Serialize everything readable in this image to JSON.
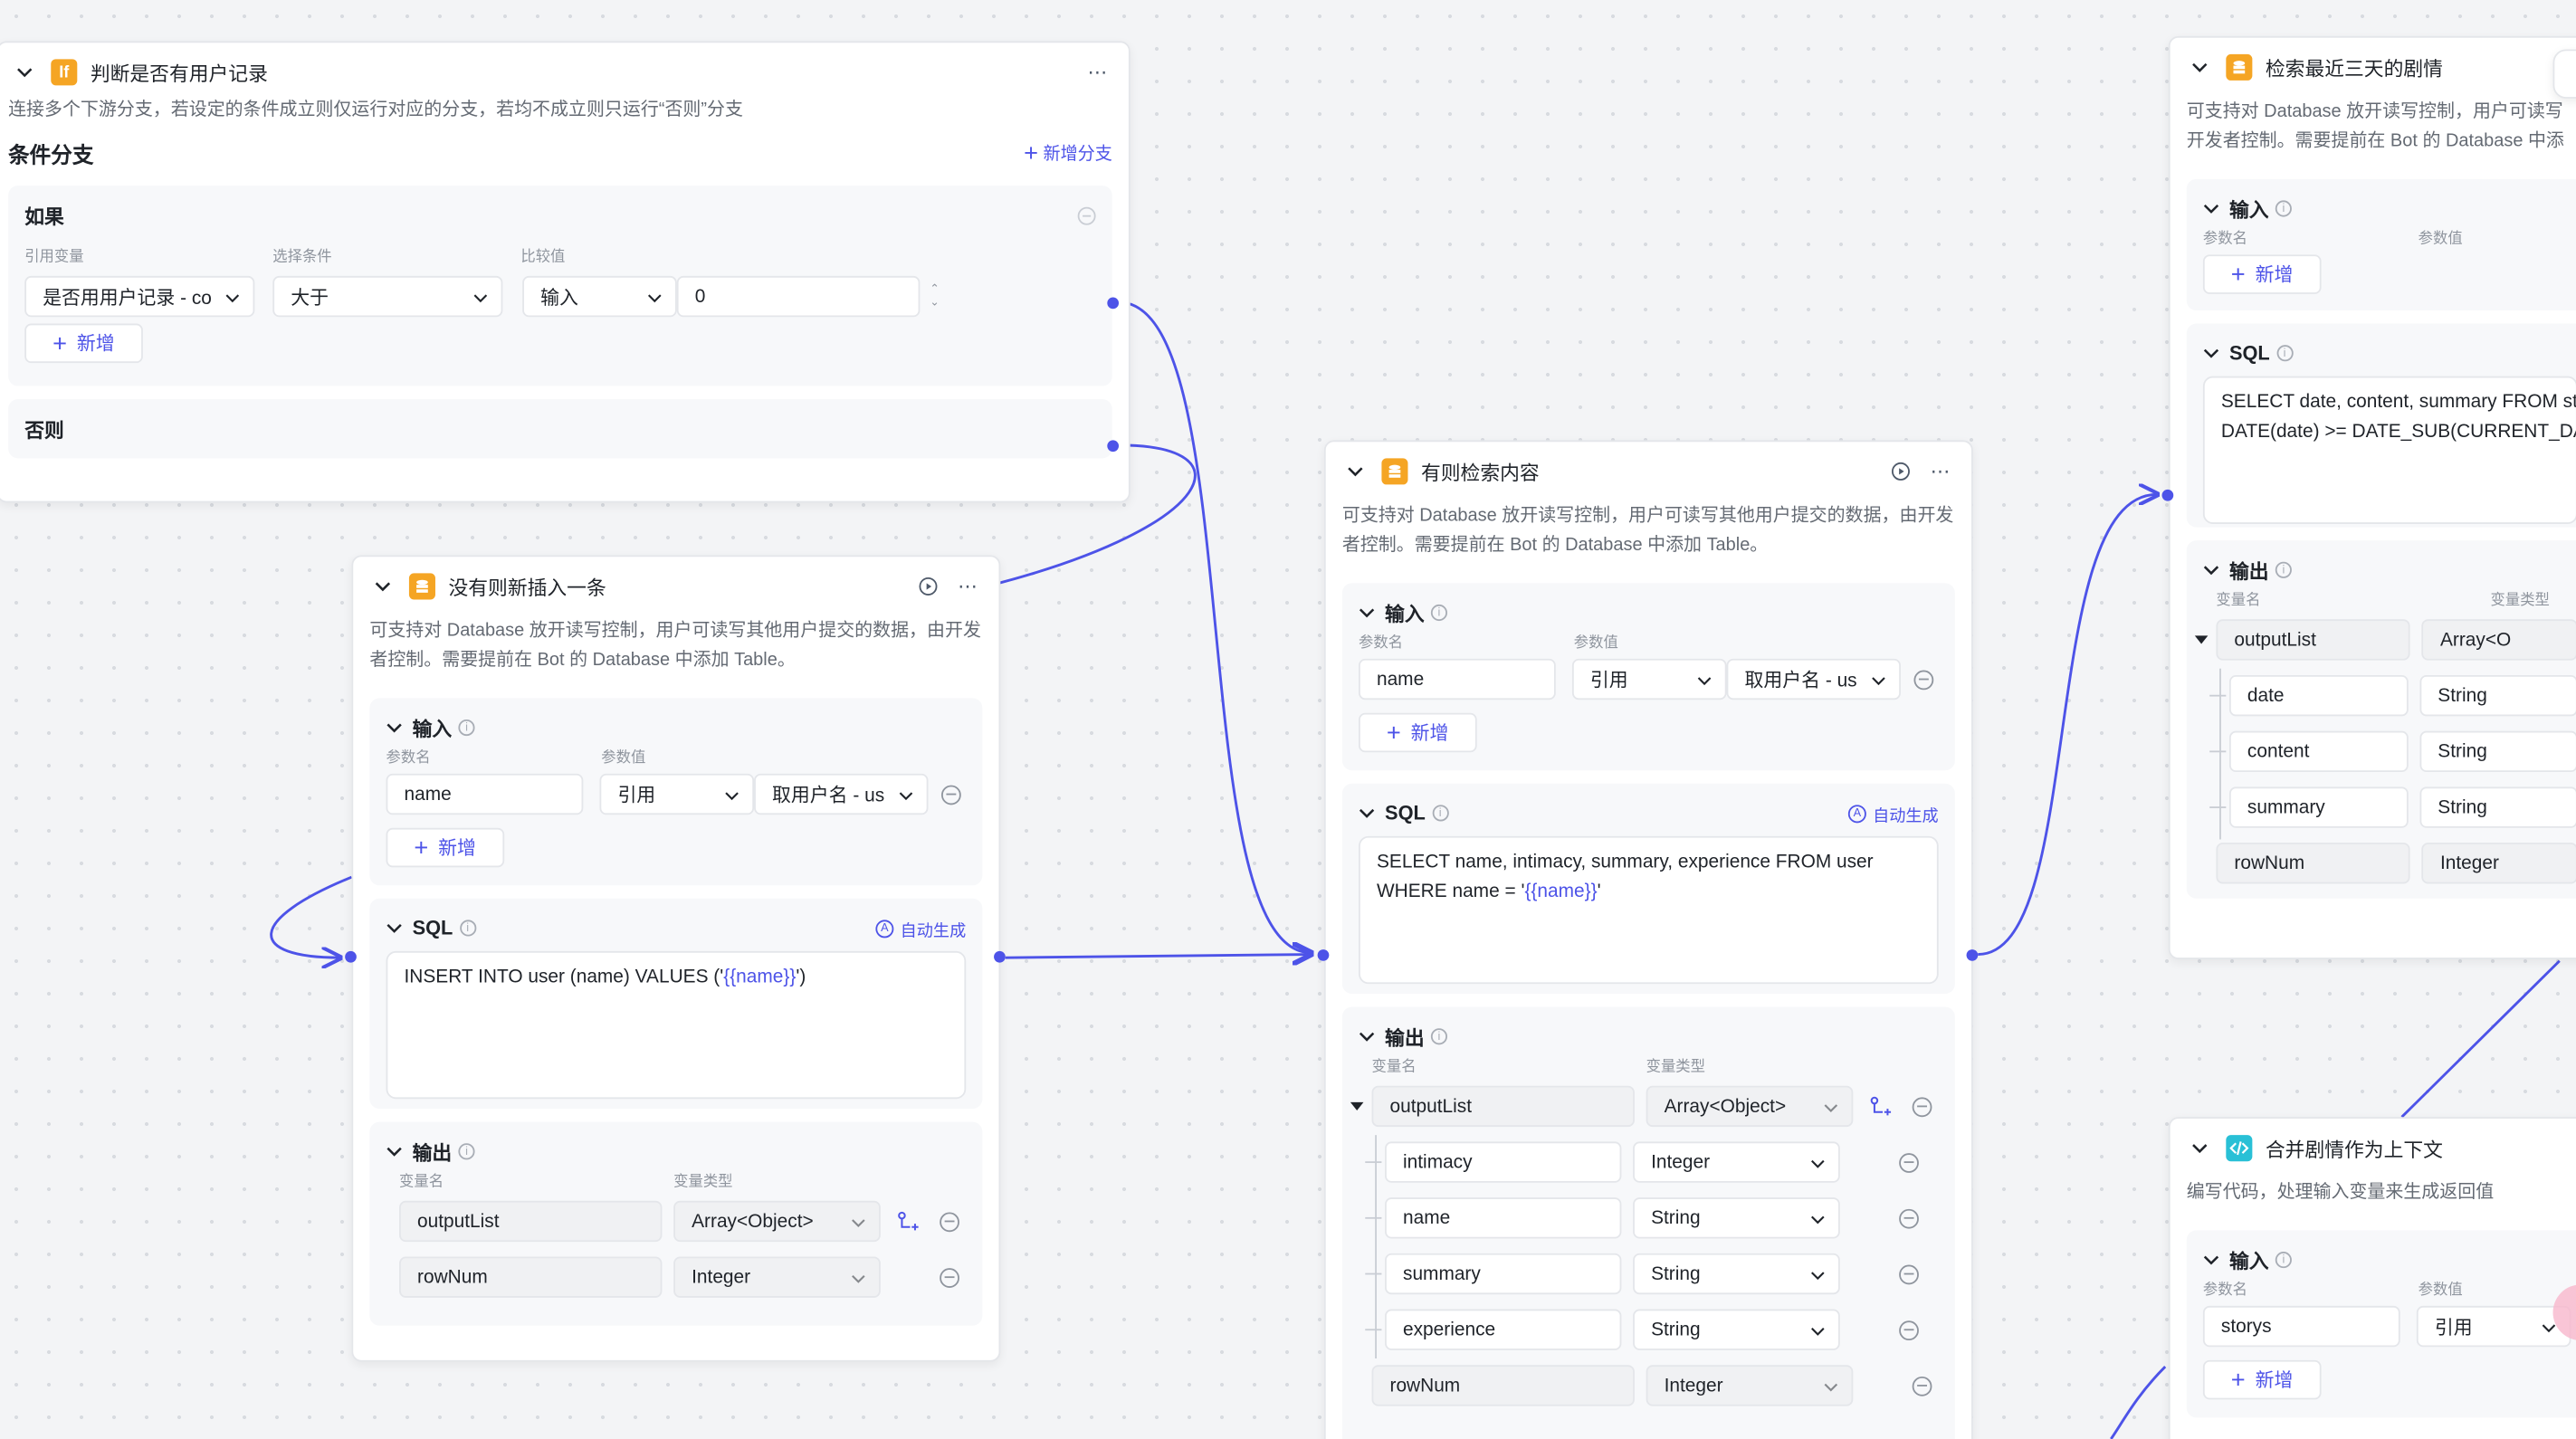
{
  "colors": {
    "accent": "#4d53e8",
    "db_icon": "#f5a524",
    "code_icon": "#29c0d6",
    "edge": "#4d53e8"
  },
  "icons": {
    "db": "database-icon",
    "if": "if-icon",
    "code": "code-icon"
  },
  "if_node": {
    "icon_text": "If",
    "title": "判断是否有用户记录",
    "desc": "连接多个下游分支，若设定的条件成立则仅运行对应的分支，若均不成立则只运行“否则”分支",
    "section_title": "条件分支",
    "add_branch": "新增分支",
    "if_label": "如果",
    "col_ref": "引用变量",
    "col_cond": "选择条件",
    "col_cmp": "比较值",
    "ref_value": "是否用用户记录 - co",
    "cond_value": "大于",
    "cmp_type": "输入",
    "cmp_value": "0",
    "add": "新增",
    "else_label": "否则"
  },
  "insert_node": {
    "title": "没有则新插入一条",
    "desc": "可支持对 Database 放开读写控制，用户可读写其他用户提交的数据，由开发者控制。需要提前在 Bot 的 Database 中添加 Table。",
    "input_title": "输入",
    "col_name": "参数名",
    "col_value": "参数值",
    "param_name": "name",
    "param_type": "引用",
    "param_ref": "取用户名 - us",
    "add": "新增",
    "sql_title": "SQL",
    "auto_gen": "自动生成",
    "sql_pre": "INSERT INTO user (name) VALUES ('",
    "sql_tpl": "{{name}}",
    "sql_post": "')",
    "output_title": "输出",
    "col_var": "变量名",
    "col_type": "变量类型",
    "out1_name": "outputList",
    "out1_type": "Array<Object>",
    "out2_name": "rowNum",
    "out2_type": "Integer"
  },
  "query_node": {
    "title": "有则检索内容",
    "desc": "可支持对 Database 放开读写控制，用户可读写其他用户提交的数据，由开发者控制。需要提前在 Bot 的 Database 中添加 Table。",
    "input_title": "输入",
    "col_name": "参数名",
    "col_value": "参数值",
    "param_name": "name",
    "param_type": "引用",
    "param_ref": "取用户名 - us",
    "add": "新增",
    "sql_title": "SQL",
    "auto_gen": "自动生成",
    "sql_line1": "SELECT name, intimacy, summary, experience FROM user",
    "sql_line2_pre": "WHERE name = '",
    "sql_tpl": "{{name}}",
    "sql_line2_post": "'",
    "output_title": "输出",
    "col_var": "变量名",
    "col_type": "变量类型",
    "out_list": "outputList",
    "out_list_type": "Array<Object>",
    "children": [
      {
        "name": "intimacy",
        "type": "Integer"
      },
      {
        "name": "name",
        "type": "String"
      },
      {
        "name": "summary",
        "type": "String"
      },
      {
        "name": "experience",
        "type": "String"
      }
    ],
    "rownum": "rowNum",
    "rownum_type": "Integer"
  },
  "recent_node": {
    "title": "检索最近三天的剧情",
    "desc_line1": "可支持对 Database 放开读写控制，用户可读写",
    "desc_line2": "开发者控制。需要提前在 Bot 的 Database 中添",
    "input_title": "输入",
    "col_name": "参数名",
    "col_value": "参数值",
    "add": "新增",
    "sql_title": "SQL",
    "sql_line1": "SELECT date, content, summary FROM st",
    "sql_line2": "DATE(date) >= DATE_SUB(CURRENT_DA",
    "output_title": "输出",
    "col_var": "变量名",
    "col_type": "变量类型",
    "out_list": "outputList",
    "out_list_type": "Array<O",
    "children": [
      {
        "name": "date",
        "type": "String"
      },
      {
        "name": "content",
        "type": "String"
      },
      {
        "name": "summary",
        "type": "String"
      }
    ],
    "rownum": "rowNum",
    "rownum_type": "Integer"
  },
  "code_node": {
    "title": "合并剧情作为上下文",
    "desc": "编写代码，处理输入变量来生成返回值",
    "input_title": "输入",
    "col_name": "参数名",
    "col_value": "参数值",
    "param_name": "storys",
    "param_type": "引用",
    "add": "新增"
  }
}
